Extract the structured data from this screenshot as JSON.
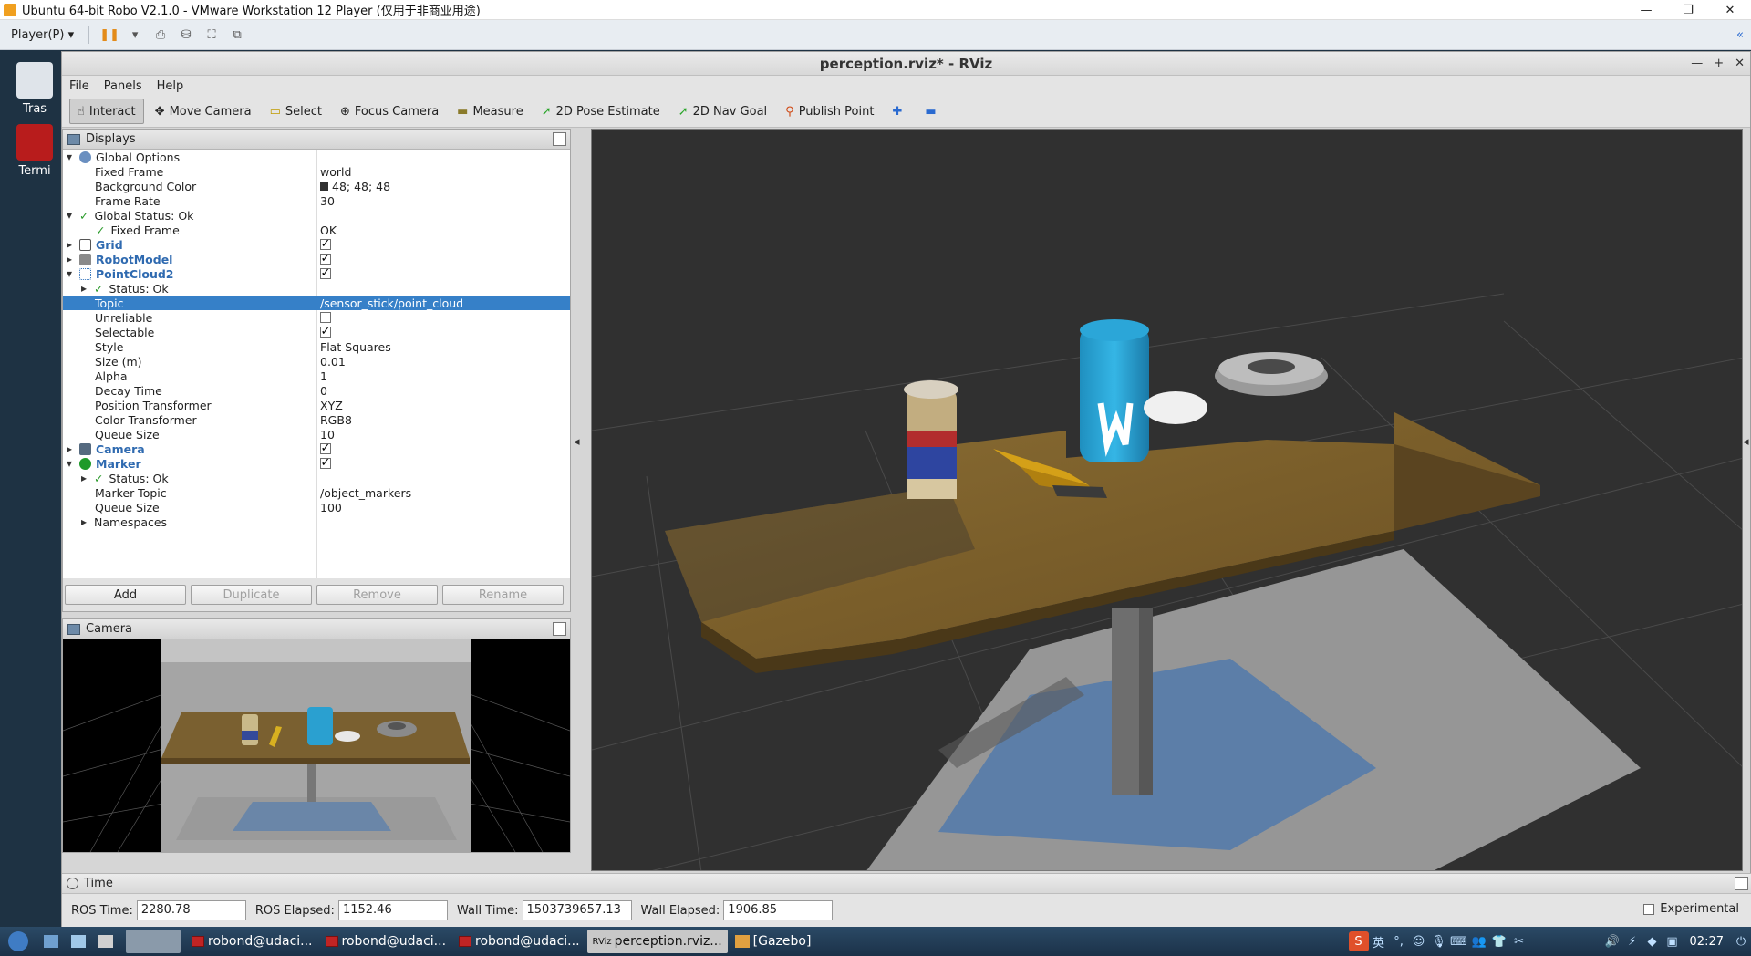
{
  "vm": {
    "title": "Ubuntu 64-bit Robo V2.1.0 - VMware Workstation 12 Player (仅用于非商业用途)",
    "player_label": "Player(P) ▾",
    "win_min": "—",
    "win_max": "❐",
    "win_close": "✕"
  },
  "desktop": {
    "icons": [
      {
        "label": "Tras"
      },
      {
        "label": "Termi"
      }
    ]
  },
  "rviz": {
    "title": "perception.rviz* - RViz",
    "menu": [
      "File",
      "Panels",
      "Help"
    ],
    "tools": [
      {
        "label": "Interact",
        "icon": "hand-icon"
      },
      {
        "label": "Move Camera",
        "icon": "move-icon"
      },
      {
        "label": "Select",
        "icon": "select-icon"
      },
      {
        "label": "Focus Camera",
        "icon": "focus-icon"
      },
      {
        "label": "Measure",
        "icon": "ruler-icon"
      },
      {
        "label": "2D Pose Estimate",
        "icon": "arrow-green-icon"
      },
      {
        "label": "2D Nav Goal",
        "icon": "arrow-green-icon"
      },
      {
        "label": "Publish Point",
        "icon": "pin-icon"
      }
    ]
  },
  "displays": {
    "title": "Displays",
    "rows": [
      {
        "name": "Global Options",
        "value": ""
      },
      {
        "name": "Fixed Frame",
        "value": "world"
      },
      {
        "name": "Background Color",
        "value": "48; 48; 48"
      },
      {
        "name": "Frame Rate",
        "value": "30"
      },
      {
        "name": "Global Status: Ok",
        "value": ""
      },
      {
        "name": "Fixed Frame",
        "value": "OK"
      },
      {
        "name": "Grid",
        "value": ""
      },
      {
        "name": "RobotModel",
        "value": ""
      },
      {
        "name": "PointCloud2",
        "value": ""
      },
      {
        "name": "Status: Ok",
        "value": ""
      },
      {
        "name": "Topic",
        "value": "/sensor_stick/point_cloud"
      },
      {
        "name": "Unreliable",
        "value": ""
      },
      {
        "name": "Selectable",
        "value": ""
      },
      {
        "name": "Style",
        "value": "Flat Squares"
      },
      {
        "name": "Size (m)",
        "value": "0.01"
      },
      {
        "name": "Alpha",
        "value": "1"
      },
      {
        "name": "Decay Time",
        "value": "0"
      },
      {
        "name": "Position Transformer",
        "value": "XYZ"
      },
      {
        "name": "Color Transformer",
        "value": "RGB8"
      },
      {
        "name": "Queue Size",
        "value": "10"
      },
      {
        "name": "Camera",
        "value": ""
      },
      {
        "name": "Marker",
        "value": ""
      },
      {
        "name": "Status: Ok",
        "value": ""
      },
      {
        "name": "Marker Topic",
        "value": "/object_markers"
      },
      {
        "name": "Queue Size",
        "value": "100"
      },
      {
        "name": "Namespaces",
        "value": ""
      }
    ],
    "buttons": {
      "add": "Add",
      "duplicate": "Duplicate",
      "remove": "Remove",
      "rename": "Rename"
    }
  },
  "camera_panel": {
    "title": "Camera"
  },
  "time": {
    "title": "Time",
    "ros_time_label": "ROS Time:",
    "ros_time": "2280.78",
    "ros_elapsed_label": "ROS Elapsed:",
    "ros_elapsed": "1152.46",
    "wall_time_label": "Wall Time:",
    "wall_time": "1503739657.13",
    "wall_elapsed_label": "Wall Elapsed:",
    "wall_elapsed": "1906.85",
    "experimental_label": "Experimental"
  },
  "taskbar": {
    "items": [
      {
        "label": "robond@udaci..."
      },
      {
        "label": "robond@udaci..."
      },
      {
        "label": "robond@udaci..."
      },
      {
        "label": "perception.rviz..."
      },
      {
        "label": "[Gazebo]"
      }
    ],
    "ime_lang": "英",
    "clock": "02:27"
  },
  "colors": {
    "accent_selection": "#3680c8",
    "background_3d": "#303030",
    "status_ok": "#2a9a2a"
  }
}
